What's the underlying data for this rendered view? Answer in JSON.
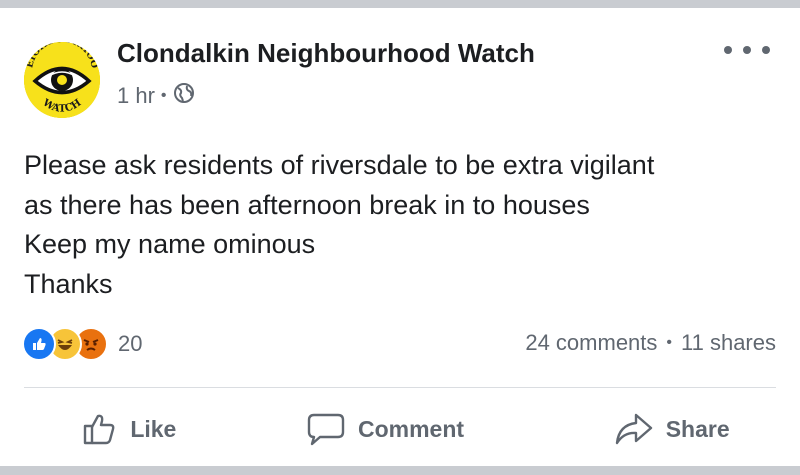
{
  "post": {
    "page_name": "Clondalkin Neighbourhood Watch",
    "time": "1 hr",
    "privacy_icon": "globe-icon",
    "avatar": {
      "logo_text_top": "NEIGHBOURHOOD",
      "logo_text_bottom": "WATCH",
      "background": "#f7e11b"
    },
    "text_lines": [
      "Please ask residents of riversdale to be extra vigilant",
      "as there has been afternoon break in to houses",
      "Keep my name ominous",
      "Thanks"
    ]
  },
  "reactions": {
    "icons": [
      "like-icon",
      "haha-icon",
      "angry-icon"
    ],
    "count": "20"
  },
  "stats": {
    "comments": "24 comments",
    "shares": "11 shares"
  },
  "actions": {
    "like_label": "Like",
    "comment_label": "Comment",
    "share_label": "Share"
  },
  "colors": {
    "like_blue": "#1877f2",
    "reaction_yellow": "#f7c439",
    "angry_orange": "#e9710f",
    "secondary_text": "#606770"
  }
}
